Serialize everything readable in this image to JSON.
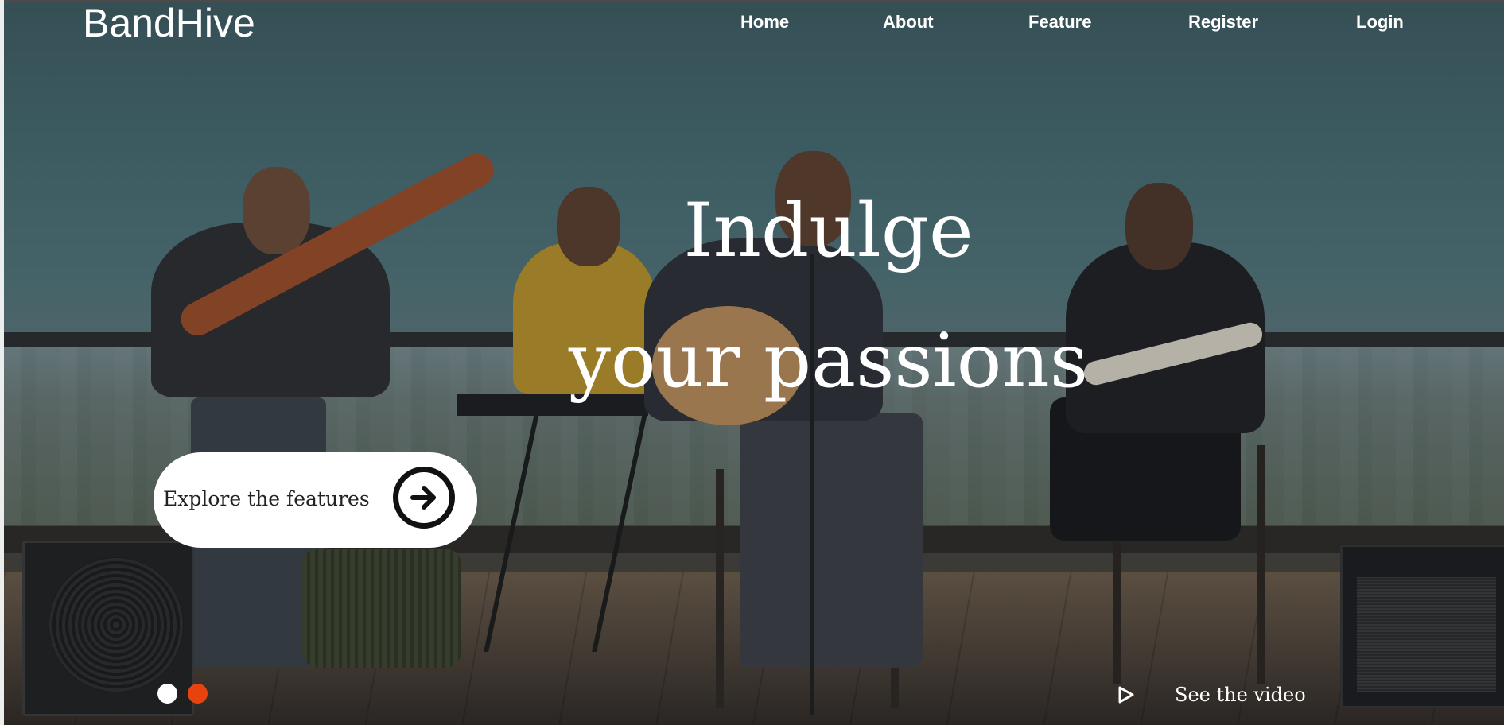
{
  "brand": {
    "logo_text": "BandHive"
  },
  "nav": {
    "items": [
      {
        "label": "Home"
      },
      {
        "label": "About"
      },
      {
        "label": "Feature"
      },
      {
        "label": "Register"
      },
      {
        "label": "Login"
      }
    ]
  },
  "hero": {
    "headline_line1": "Indulge",
    "headline_line2": "your passions",
    "cta_label": "Explore the features",
    "cta_icon": "arrow-right-circle-icon",
    "video_label": "See the video",
    "video_icon": "play-icon",
    "slider": {
      "count": 2,
      "active_index": 1,
      "active_color": "#e8430f",
      "inactive_color": "#ffffff"
    }
  }
}
